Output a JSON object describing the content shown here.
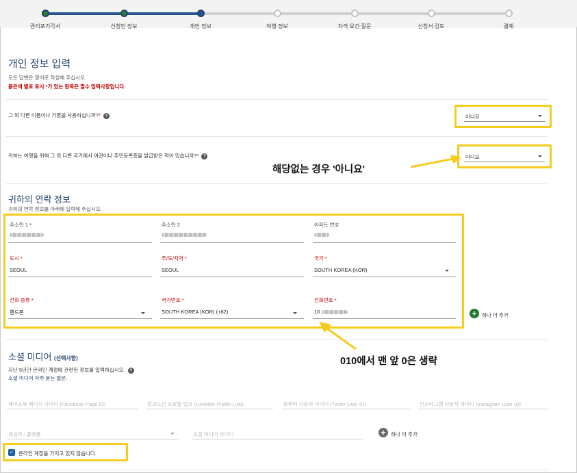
{
  "steps": [
    {
      "label": "권리포기각서"
    },
    {
      "label": "신청인 정보"
    },
    {
      "label": "개인 정보"
    },
    {
      "label": "여행 정보"
    },
    {
      "label": "자격 요건 질문"
    },
    {
      "label": "신청서 검토"
    },
    {
      "label": "결제"
    }
  ],
  "page": {
    "title": "개인 정보 입력",
    "instruction": "모든 답변은 영어로 작성해 주십시오.",
    "required_note": "붉은색 별표 표시 *가 있는 항목은 필수 입력사항입니다."
  },
  "questions": {
    "other_names": {
      "text": "그 외 다른 이름이나 가명을 사용하십니까?",
      "star": "*",
      "value": "아니요"
    },
    "other_passport": {
      "text": "귀하는 여행을 위해 그 외 다른 국가에서 여권이나 주민등록증을 발급받은 적이 있습니까?",
      "star": "*",
      "value": "아니요"
    }
  },
  "contact": {
    "title": "귀하의 연락 정보",
    "subtitle": "귀하의 연락 정보를 아래에 입력해 주십시오.",
    "fields": {
      "address1": {
        "label": "주소란 1",
        "star": "*"
      },
      "address2": {
        "label": "주소란 2"
      },
      "apartment": {
        "label": "아파트 번호"
      },
      "city": {
        "label": "도시",
        "star": "*",
        "value": "SEOUL"
      },
      "state": {
        "label": "주/도/지역",
        "star": "*",
        "value": "SEOUL"
      },
      "country": {
        "label": "국가",
        "star": "*",
        "value": "SOUTH KOREA (KOR)"
      },
      "phone_type": {
        "label": "전화 종류",
        "star": "*",
        "value": "핸드폰"
      },
      "country_code": {
        "label": "국가번호",
        "star": "*",
        "value": "SOUTH KOREA (KOR) (+82)"
      },
      "phone_number": {
        "label": "전화번호",
        "star": "*",
        "value": "10"
      }
    },
    "add_more": "하나 더 추가"
  },
  "social": {
    "title": "소셜 미디어",
    "title_note": "(선택사항)",
    "desc": "지난 5년간 온라인 계정에 관련된 정보를 입력하십시오.",
    "faq": "소셜 미디어 자주 묻는 질문.",
    "placeholders": [
      "페이스북 페이지 아이디 (Facebook Page ID)",
      "링크드인 프로필 링크 (LinkedIn Profile Link)",
      "트위터 사용자 아이디 (Twiter User ID)",
      "인스타그램 사용자 아이디 (Instagram User ID)"
    ],
    "provider_placeholder": "제공자 / 플랫폼",
    "id_placeholder": "소셜 미디어 아이디",
    "add_more": "하나 더 추가",
    "no_account": "온라인 계정을 가지고 있지 않습니다."
  },
  "annotations": {
    "no_hint": "해당없는 경우 '아니요'",
    "phone_hint_num1": "010",
    "phone_hint_mid": "에서 맨 앞 ",
    "phone_hint_num2": "0",
    "phone_hint_end": "은 생략"
  },
  "colors": {
    "highlight": "#f4cc1c",
    "progress_done": "#2e7d32",
    "progress_current": "#27548f",
    "heading": "#24466f",
    "required": "#c00000"
  },
  "icons": {
    "help": "question-circle-icon",
    "caret": "chevron-down-icon",
    "add": "plus-circle-icon",
    "check": "checkbox-checked-icon",
    "arrow": "arrow-annotation-icon"
  }
}
